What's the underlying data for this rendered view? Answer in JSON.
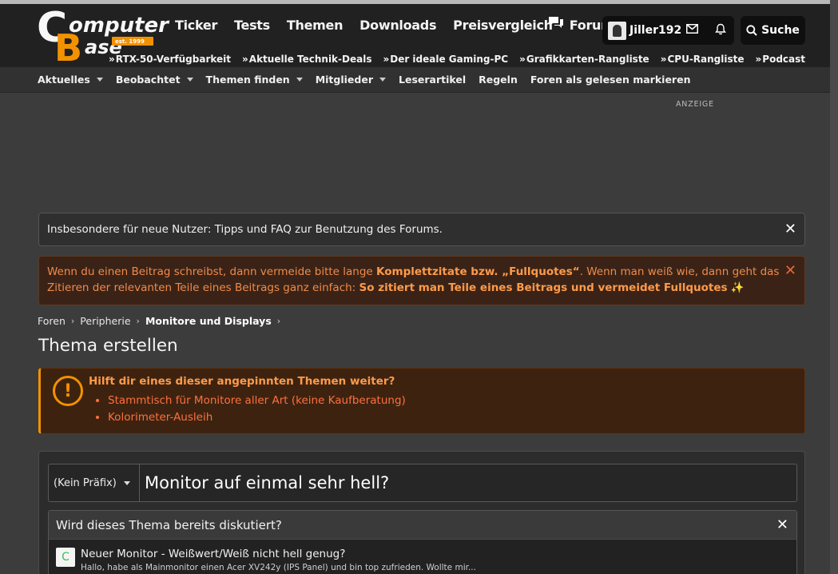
{
  "logo": {
    "word1": "omputer",
    "word2": "ase",
    "letter1": "C",
    "letter2": "B",
    "est": "est. 1999"
  },
  "main_nav": [
    "Ticker",
    "Tests",
    "Themen",
    "Downloads",
    "Preisvergleich",
    "Forum"
  ],
  "user": {
    "name": "Jiller192"
  },
  "search": {
    "label": "Suche"
  },
  "quicklinks": [
    "RTX-50-Verfügbarkeit",
    "Aktuelle Technik-Deals",
    "Der ideale Gaming-PC",
    "Grafikkarten-Rangliste",
    "CPU-Rangliste",
    "Podcast"
  ],
  "sub_nav": [
    {
      "label": "Aktuelles",
      "dropdown": true
    },
    {
      "label": "Beobachtet",
      "dropdown": true
    },
    {
      "label": "Themen finden",
      "dropdown": true
    },
    {
      "label": "Mitglieder",
      "dropdown": true
    },
    {
      "label": "Leserartikel",
      "dropdown": false
    },
    {
      "label": "Regeln",
      "dropdown": false
    },
    {
      "label": "Foren als gelesen markieren",
      "dropdown": false
    }
  ],
  "ad": {
    "label": "ANZEIGE"
  },
  "notice_tips": {
    "text": "Insbesondere für neue Nutzer: Tipps und FAQ zur Benutzung des Forums."
  },
  "notice_quotes": {
    "part1": "Wenn du einen Beitrag schreibst, dann vermeide bitte lange ",
    "bold1": "Komplettzitate bzw. „Fullquotes“",
    "part2": ". Wenn man weiß wie, dann geht das Zitieren der relevanten Teile eines Beitrags ganz einfach: ",
    "bold2": "So zitiert man Teile eines Beitrags und vermeidet Fullquotes",
    "emoji": "✨"
  },
  "breadcrumb": [
    "Foren",
    "Peripherie",
    "Monitore und Displays"
  ],
  "page_title": "Thema erstellen",
  "pinned": {
    "title": "Hilft dir eines dieser angepinnten Themen weiter?",
    "items": [
      "Stammtisch für Monitore aller Art (keine Kaufberatung)",
      "Kolorimeter-Ausleih"
    ]
  },
  "form": {
    "prefix": "(Kein Präfix)",
    "title_value": "Monitor auf einmal sehr hell?"
  },
  "similar": {
    "heading": "Wird dieses Thema bereits diskutiert?",
    "items": [
      {
        "icon_letter": "C",
        "title": "Neuer Monitor - Weißwert/Weiß nicht hell genug?",
        "snippet": "Hallo, habe als Mainmonitor einen Acer XV242y (IPS Panel) und bin top zufrieden. Wollte mir..."
      }
    ]
  },
  "colors": {
    "accent": "#f39200",
    "warning_text": "#ff6f3f"
  }
}
